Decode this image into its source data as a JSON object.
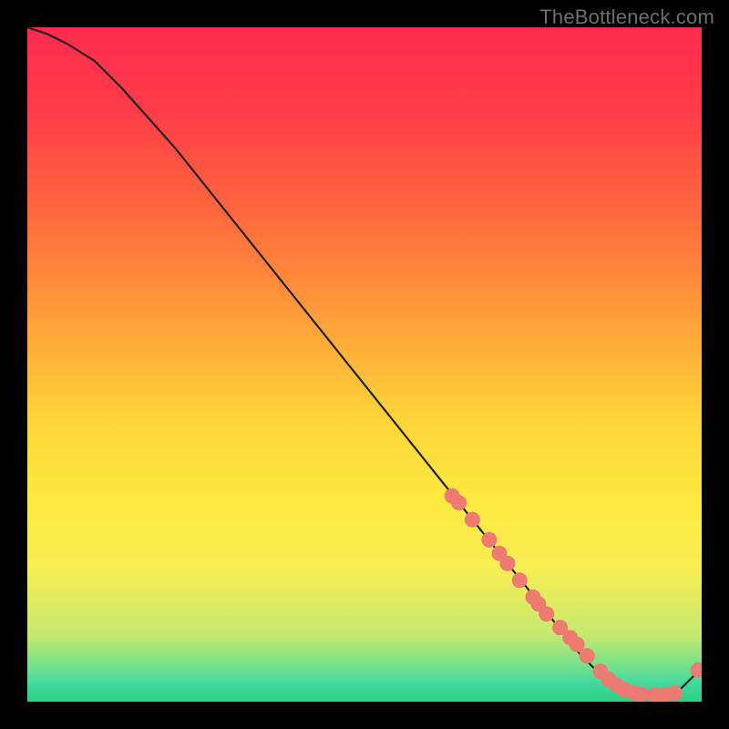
{
  "watermark": "TheBottleneck.com",
  "colors": {
    "gradient_top": "#ff2b4e",
    "gradient_mid_upper": "#ff6a3d",
    "gradient_mid": "#ffd43a",
    "gradient_mid_lower": "#f7ee52",
    "gradient_teal": "#3fd7a0",
    "gradient_bottom": "#29d47d",
    "marker_fill": "#ed7b72",
    "line": "#222222",
    "page_bg": "#000000"
  },
  "chart_data": {
    "type": "line",
    "title": "",
    "xlabel": "",
    "ylabel": "",
    "xlim": [
      0,
      100
    ],
    "ylim": [
      0,
      100
    ],
    "series": [
      {
        "name": "curve",
        "x": [
          0,
          3,
          6,
          10,
          14,
          18,
          22,
          26,
          30,
          34,
          38,
          42,
          46,
          50,
          54,
          58,
          62,
          66,
          70,
          74,
          78,
          82,
          85,
          88,
          91,
          94,
          97,
          100
        ],
        "values": [
          100,
          99,
          97.5,
          95,
          91,
          86.5,
          82,
          77,
          72,
          67,
          62,
          57,
          52,
          47,
          42,
          37,
          32,
          27,
          22,
          17,
          12,
          7,
          4,
          2,
          1,
          1,
          2,
          5
        ]
      }
    ],
    "markers": {
      "name": "highlighted-points",
      "x": [
        63,
        64,
        66,
        68.5,
        70,
        71.2,
        73,
        75,
        75.8,
        77,
        79,
        80.5,
        81.5,
        83,
        85,
        86.2,
        87.4,
        88.5,
        90,
        91,
        93,
        94.5,
        96,
        99.5
      ],
      "values": [
        30.5,
        29.5,
        27,
        24,
        22,
        20.5,
        18,
        15.5,
        14.5,
        13,
        11,
        9.5,
        8.5,
        6.8,
        4.5,
        3.3,
        2.4,
        1.8,
        1.3,
        1.1,
        1.0,
        1.0,
        1.3,
        4.7
      ]
    },
    "gradient_stops": [
      {
        "offset": 0.0,
        "color": "#ff2b4e"
      },
      {
        "offset": 0.12,
        "color": "#ff3b49"
      },
      {
        "offset": 0.28,
        "color": "#ff6a3d"
      },
      {
        "offset": 0.42,
        "color": "#ff9a3a"
      },
      {
        "offset": 0.58,
        "color": "#ffd43a"
      },
      {
        "offset": 0.7,
        "color": "#fce93f"
      },
      {
        "offset": 0.8,
        "color": "#f7ee52"
      },
      {
        "offset": 0.9,
        "color": "#c7e96e"
      },
      {
        "offset": 0.95,
        "color": "#6fe08c"
      },
      {
        "offset": 0.975,
        "color": "#3fd7a0"
      },
      {
        "offset": 1.0,
        "color": "#29d47d"
      }
    ]
  }
}
